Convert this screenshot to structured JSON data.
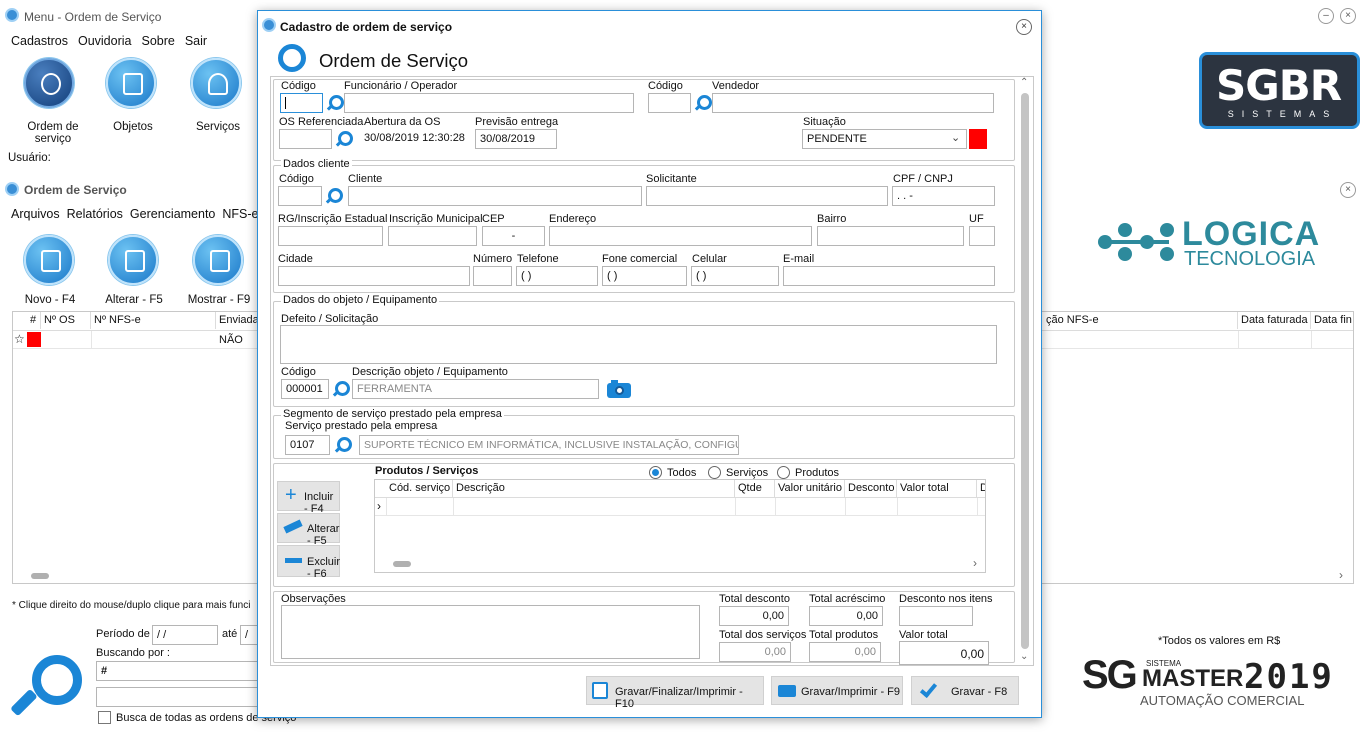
{
  "menu_window": {
    "title": "Menu - Ordem de Serviço",
    "menu": [
      "Cadastros",
      "Ouvidoria",
      "Sobre",
      "Sair"
    ],
    "shortcuts": [
      {
        "label": "Ordem de serviço",
        "icon": "gear-tools-icon"
      },
      {
        "label": "Objetos",
        "icon": "box-icon"
      },
      {
        "label": "Serviços",
        "icon": "hand-service-icon"
      }
    ],
    "user_label": "Usuário:"
  },
  "os_window": {
    "title": "Ordem de Serviço",
    "menu": [
      "Arquivos",
      "Relatórios",
      "Gerenciamento",
      "NFS-e"
    ],
    "actions": [
      {
        "label": "Novo - F4",
        "icon": "new-document-icon"
      },
      {
        "label": "Alterar - F5",
        "icon": "edit-document-icon"
      },
      {
        "label": "Mostrar - F9",
        "icon": "view-document-icon"
      }
    ],
    "columns": [
      "#",
      "Nº OS",
      "Nº NFS-e",
      "Enviada"
    ],
    "right_columns": [
      "ção NFS-e",
      "Data faturada",
      "Data fin"
    ],
    "row": {
      "enviada": "NÃO"
    },
    "hint": "* Clique direito do mouse/duplo clique para mais funci",
    "periodo_label": "Período de",
    "periodo_from": " / /",
    "ate_label": "até",
    "periodo_to": " /",
    "buscando_label": "Buscando por :",
    "buscando_value": "#",
    "busca_todas_label": "Busca de todas as ordens de serviço",
    "footnote": "*Todos os valores em R$"
  },
  "brand": {
    "sgbr": "SGBR",
    "sgbr_sub": "SISTEMAS",
    "logica": "LOGICA",
    "logica_sub": "TECNOLOGIA",
    "sg_master": "SG",
    "sg_master_small": "SISTEMA",
    "sg_master_word": "MASTER",
    "sg_master_year": "2019",
    "sg_master_sub": "AUTOMAÇÃO COMERCIAL"
  },
  "dialog": {
    "title": "Cadastro de ordem de serviço",
    "heading": "Ordem de Serviço",
    "codigo_label": "Código",
    "codigo_value": "",
    "funcionario_label": "Funcionário / Operador",
    "funcionario_value": "",
    "codigo2_label": "Código",
    "vendedor_label": "Vendedor",
    "os_ref_label": "OS Referenciada",
    "abertura_label": "Abertura da OS",
    "abertura_value": "30/08/2019 12:30:28",
    "previsao_label": "Previsão entrega",
    "previsao_value": "30/08/2019",
    "situacao_label": "Situação",
    "situacao_value": "PENDENTE",
    "situacao_color": "#ff0000",
    "cliente_group": "Dados cliente",
    "c_codigo_label": "Código",
    "cliente_label": "Cliente",
    "solicitante_label": "Solicitante",
    "cpf_label": "CPF / CNPJ",
    "cpf_value": " .  .  -",
    "rg_label": "RG/Inscrição Estadual",
    "im_label": "Inscrição Municipal",
    "cep_label": "CEP",
    "cep_value": "-",
    "endereco_label": "Endereço",
    "bairro_label": "Bairro",
    "uf_label": "UF",
    "cidade_label": "Cidade",
    "numero_label": "Número",
    "telefone_label": "Telefone",
    "telefone_value": "( )",
    "fone_com_label": "Fone comercial",
    "fone_com_value": "( )",
    "celular_label": "Celular",
    "celular_value": "( )",
    "email_label": "E-mail",
    "objeto_group": "Dados do objeto / Equipamento",
    "defeito_label": "Defeito / Solicitação",
    "obj_codigo_label": "Código",
    "obj_codigo_value": "000001",
    "obj_desc_label": "Descrição objeto / Equipamento",
    "obj_desc_value": "FERRAMENTA",
    "segmento_group": "Segmento de serviço prestado pela empresa",
    "servico_label": "Serviço prestado pela  empresa",
    "servico_codigo": "0107",
    "servico_desc": "SUPORTE TÉCNICO EM INFORMÁTICA, INCLUSIVE INSTALAÇÃO, CONFIGURA",
    "produtos_title": "Produtos / Serviços",
    "filters": [
      "Todos",
      "Serviços",
      "Produtos"
    ],
    "filter_selected": "Todos",
    "grid_cols": [
      "Cód. serviço",
      "Descrição",
      "Qtde",
      "Valor unitário",
      "Desconto",
      "Valor total",
      "D"
    ],
    "btn_incluir": "Incluir - F4",
    "btn_alterar": "Alterar - F5",
    "btn_excluir": "Excluir - F6",
    "obs_label": "Observações",
    "total_desconto_label": "Total desconto",
    "total_desconto_value": "0,00",
    "total_acrescimo_label": "Total acréscimo",
    "total_acrescimo_value": "0,00",
    "desc_itens_label": "Desconto nos itens",
    "desc_itens_value": "",
    "total_servicos_label": "Total dos serviços",
    "total_servicos_value": "0,00",
    "total_produtos_label": "Total produtos",
    "total_produtos_value": "0,00",
    "valor_total_label": "Valor total",
    "valor_total_value": "0,00",
    "btn_gravar_finalizar": "Gravar/Finalizar/Imprimir - F10",
    "btn_gravar_imprimir": "Gravar/Imprimir - F9",
    "btn_gravar": "Gravar - F8"
  },
  "colors": {
    "accent": "#1b86d6",
    "status_red": "#ff0000",
    "sgbr_bg": "#2c3440",
    "logica_teal": "#2d8a9c"
  }
}
